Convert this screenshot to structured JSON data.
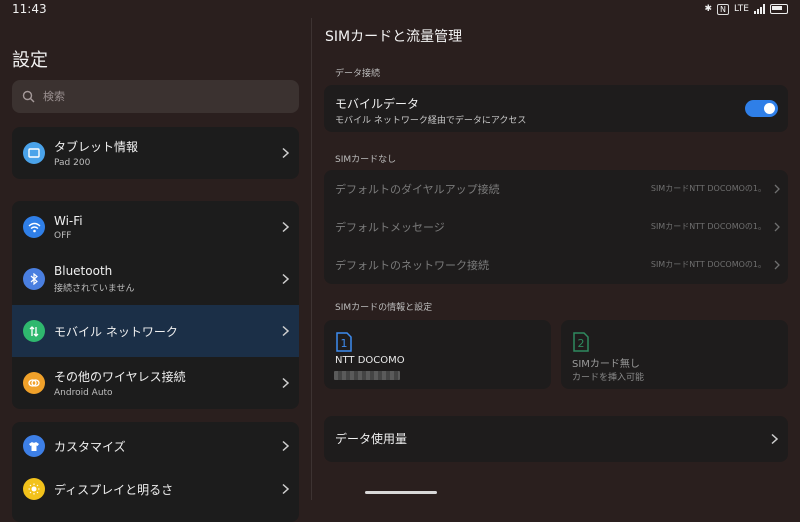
{
  "status": {
    "time": "11:43",
    "network": "LTE"
  },
  "left": {
    "title": "設定",
    "search_placeholder": "検索",
    "groups": [
      {
        "items": [
          {
            "label": "タブレット情報",
            "sub": "Pad 200",
            "icon": "tablet-icon",
            "color": "#4aa3ea"
          }
        ]
      },
      {
        "items": [
          {
            "label": "Wi-Fi",
            "sub": "OFF",
            "icon": "wifi-icon",
            "color": "#2f7fe8"
          },
          {
            "label": "Bluetooth",
            "sub": "接続されていません",
            "icon": "bluetooth-icon",
            "color": "#4a7fe0"
          },
          {
            "label": "モバイル ネットワーク",
            "sub": "",
            "icon": "mobile-network-icon",
            "color": "#2fb86e",
            "selected": true
          },
          {
            "label": "その他のワイヤレス接続",
            "sub": "Android Auto",
            "icon": "wireless-icon",
            "color": "#f0a12a"
          }
        ]
      },
      {
        "items": [
          {
            "label": "カスタマイズ",
            "sub": "",
            "icon": "shirt-icon",
            "color": "#3d7fe6"
          },
          {
            "label": "ディスプレイと明るさ",
            "sub": "",
            "icon": "sun-icon",
            "color": "#f2c21b"
          }
        ]
      }
    ]
  },
  "right": {
    "title": "SIMカードと流量管理",
    "data_section": "データ接続",
    "mobile_data": {
      "label": "モバイルデータ",
      "sub": "モバイル ネットワーク経由でデータにアクセス",
      "on": true
    },
    "nosim_section": "SIMカードなし",
    "nosim_rows": [
      {
        "label": "デフォルトのダイヤルアップ接続",
        "value": "SIMカードNTT DOCOMOの1。"
      },
      {
        "label": "デフォルトメッセージ",
        "value": "SIMカードNTT DOCOMOの1。"
      },
      {
        "label": "デフォルトのネットワーク接続",
        "value": "SIMカードNTT DOCOMOの1。"
      }
    ],
    "siminfo_section": "SIMカードの情報と設定",
    "sim1": {
      "slot": "1",
      "name": "NTT DOCOMO"
    },
    "sim2": {
      "slot": "2",
      "name": "SIMカード無し",
      "sub": "カードを挿入可能"
    },
    "data_usage": "データ使用量"
  },
  "colors": {
    "accent": "#2f7fe8",
    "selected_bg": "#1b2f47",
    "sim1": "#3d8cf0",
    "sim2": "#2f8a5f"
  }
}
